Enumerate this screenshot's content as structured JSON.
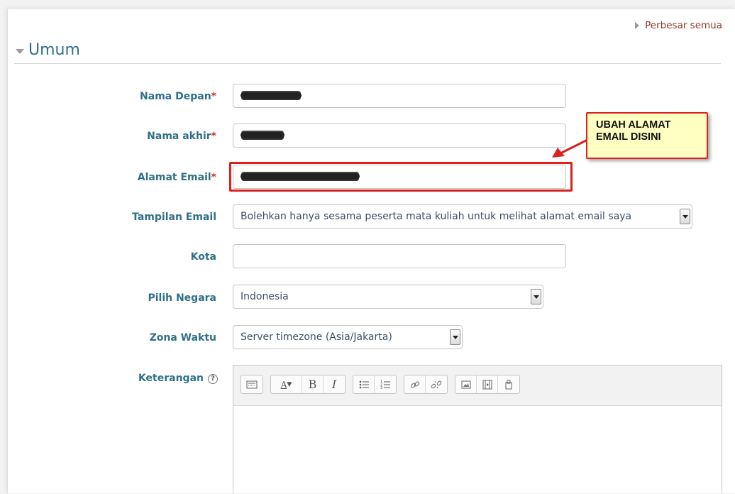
{
  "header": {
    "expand_all": "Perbesar semua",
    "section_title": "Umum"
  },
  "fields": {
    "first_name_label": "Nama Depan",
    "last_name_label": "Nama akhir",
    "email_label": "Alamat Email",
    "email_display_label": "Tampilan Email",
    "email_display_value": "Bolehkan hanya sesama peserta mata kuliah untuk melihat alamat email saya",
    "city_label": "Kota",
    "city_value": "",
    "country_label": "Pilih Negara",
    "country_value": "Indonesia",
    "timezone_label": "Zona Waktu",
    "timezone_value": "Server timezone (Asia/Jakarta)",
    "description_label": "Keterangan",
    "required_mark": "*"
  },
  "annotation": {
    "callout_text": "UBAH ALAMAT EMAIL DISINI",
    "color": "#d92121"
  },
  "editor_toolbar": {
    "groups": [
      [
        "toolbar-toggle-icon"
      ],
      [
        "font-style-icon",
        "bold-icon",
        "italic-icon"
      ],
      [
        "unordered-list-icon",
        "ordered-list-icon"
      ],
      [
        "link-icon",
        "unlink-icon"
      ],
      [
        "image-icon",
        "media-icon",
        "manage-files-icon"
      ]
    ],
    "bold_glyph": "B",
    "italic_glyph": "I",
    "font_glyph": "A"
  },
  "colors": {
    "label": "#2f6f8a",
    "required": "#c0392b",
    "link": "#8a3a2a"
  }
}
